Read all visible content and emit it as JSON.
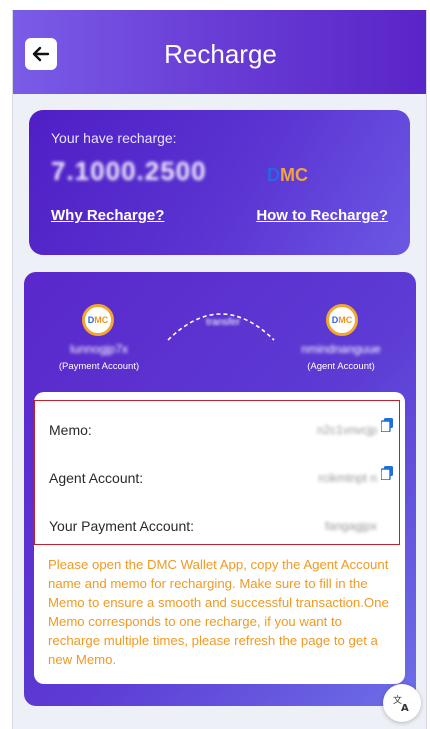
{
  "header": {
    "title": "Recharge"
  },
  "balance": {
    "label": "Your have recharge:",
    "amount": "7.1000.2500",
    "unit_d": "D",
    "unit_mc": "MC",
    "why_link": "Why Recharge?",
    "how_link": "How to Recharge?"
  },
  "transfer": {
    "coin_left_d": "D",
    "coin_left_mc": "MC",
    "coin_right_d": "D",
    "coin_right_mc": "MC",
    "arc_label": "transfer",
    "left_account_name": "lunnogjp7x",
    "left_account_role": "(Payment Account)",
    "right_account_name": "nmindnanguue",
    "right_account_role": "(Agent Account)"
  },
  "info": {
    "memo_label": "Memo:",
    "memo_value": "n2c1vnvcjp",
    "agent_label": "Agent Account:",
    "agent_value": "rcikmtnpt n",
    "payment_label": "Your Payment Account:",
    "payment_value": "fangagjpx"
  },
  "notice": "Please open the DMC Wallet App, copy the Agent Account name and memo for recharging. Make sure to fill in the Memo to ensure a smooth and successful transaction.One Memo corresponds to one recharge, if you want to recharge multiple times, please refresh the page to get a new Memo.",
  "colors": {
    "header_gradient_start": "#7a5ce8",
    "header_gradient_end": "#5a24c8",
    "notice_text": "#f09a23",
    "highlight_border": "#c21f2b",
    "coin_ring": "#f2a630"
  },
  "icons": {
    "back": "arrow-left-icon",
    "copy": "copy-icon",
    "translate": "translate-icon"
  }
}
